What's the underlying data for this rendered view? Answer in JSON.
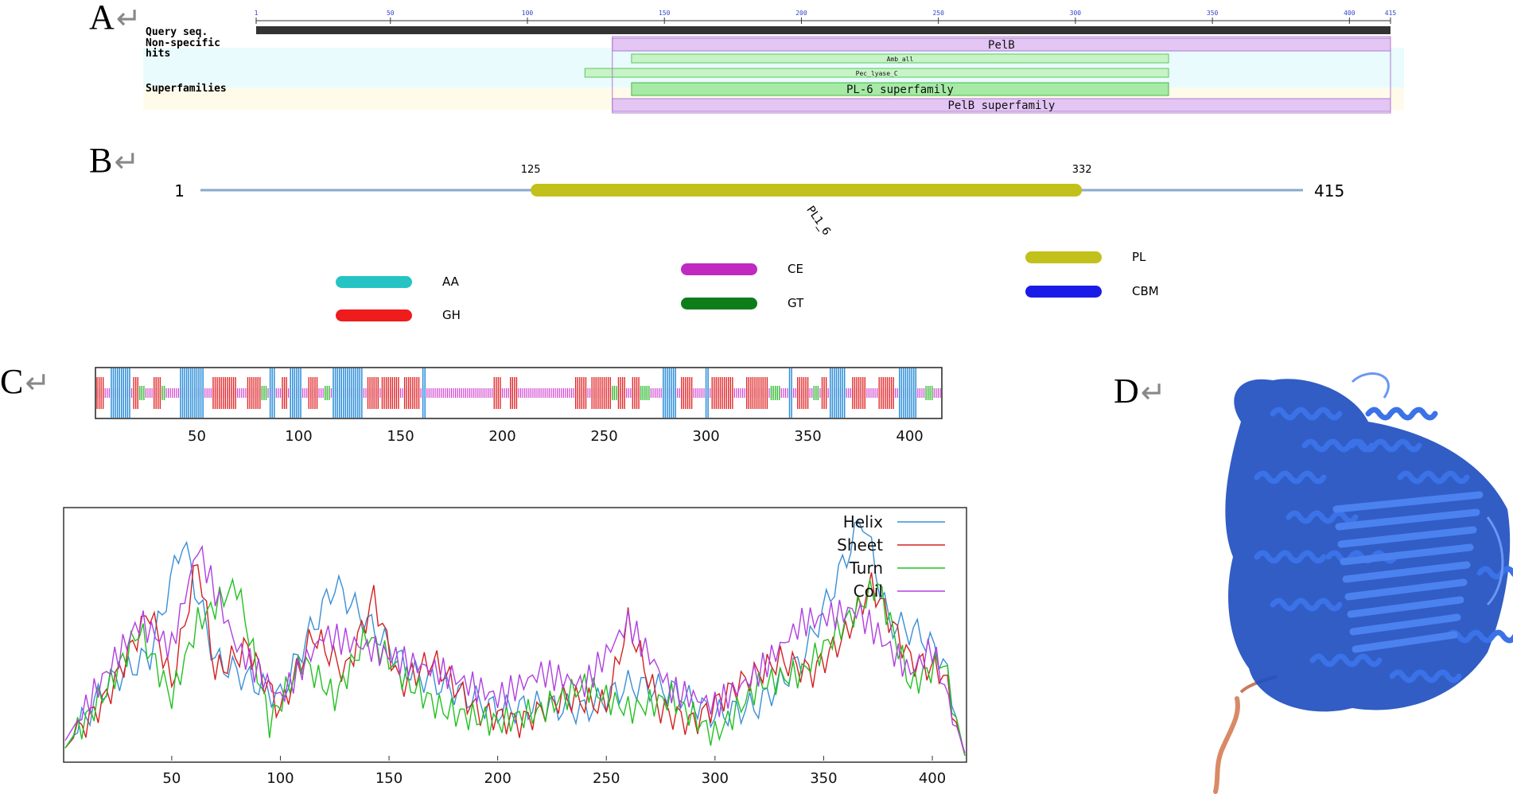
{
  "panels": [
    {
      "letter": "A",
      "mark": "↵"
    },
    {
      "letter": "B",
      "mark": "↵"
    },
    {
      "letter": "C",
      "mark": "↵"
    },
    {
      "letter": "D",
      "mark": "↵"
    }
  ],
  "panel_a": {
    "row_labels": [
      "Query seq.",
      "Non-specific",
      "hits",
      "Superfamilies"
    ],
    "ticks": [
      "1",
      "50",
      "100",
      "150",
      "200",
      "250",
      "300",
      "350",
      "400",
      "415"
    ],
    "tick_values": [
      1,
      50,
      100,
      150,
      200,
      250,
      300,
      350,
      400,
      415
    ],
    "domains": [
      {
        "label": "PelB",
        "start": 131,
        "end": 415,
        "row": 0,
        "color": "#e3c6f4",
        "stroke": "#b07ad0"
      },
      {
        "label": "Amb_all",
        "start": 138,
        "end": 334,
        "row": 1,
        "color": "#c7f3c7",
        "stroke": "#5cc85c"
      },
      {
        "label": "Pec_lyase_C",
        "start": 121,
        "end": 334,
        "row": 2,
        "color": "#c7f3c7",
        "stroke": "#5cc85c"
      },
      {
        "label": "PL-6 superfamily",
        "start": 138,
        "end": 334,
        "row": 3,
        "color": "#a6eaa6",
        "stroke": "#45b845"
      },
      {
        "label": "PelB superfamily",
        "start": 131,
        "end": 415,
        "row": 4,
        "color": "#e3c6f4",
        "stroke": "#b07ad0"
      }
    ]
  },
  "panel_b": {
    "start_label": "1",
    "end_label": "415",
    "domain": {
      "start": 125,
      "end": 332,
      "start_label": "125",
      "end_label": "332",
      "name": "PL1_6",
      "color": "#c2c01a"
    },
    "legend": [
      {
        "label": "AA",
        "color": "#25c4c4"
      },
      {
        "label": "GH",
        "color": "#ee1c1c"
      },
      {
        "label": "CE",
        "color": "#c02ac0"
      },
      {
        "label": "GT",
        "color": "#0d7d1a"
      },
      {
        "label": "PL",
        "color": "#c2c01a"
      },
      {
        "label": "CBM",
        "color": "#1b1be8"
      }
    ]
  },
  "panel_c_track": {
    "ticks": [
      "50",
      "100",
      "150",
      "200",
      "250",
      "300",
      "350",
      "400"
    ],
    "tick_values": [
      50,
      100,
      150,
      200,
      250,
      300,
      350,
      400
    ],
    "helix_blocks": [
      [
        8,
        17
      ],
      [
        42,
        53
      ],
      [
        86,
        88
      ],
      [
        96,
        101
      ],
      [
        117,
        131
      ],
      [
        161,
        162
      ],
      [
        279,
        285
      ],
      [
        300,
        301
      ],
      [
        341,
        342
      ],
      [
        361,
        368
      ],
      [
        395,
        403
      ]
    ],
    "sheet_blocks": [
      [
        1,
        4
      ],
      [
        19,
        21
      ],
      [
        29,
        32
      ],
      [
        58,
        69
      ],
      [
        75,
        81
      ],
      [
        92,
        94
      ],
      [
        105,
        109
      ],
      [
        134,
        139
      ],
      [
        141,
        149
      ],
      [
        152,
        159
      ],
      [
        196,
        199
      ],
      [
        204,
        207
      ],
      [
        236,
        241
      ],
      [
        244,
        253
      ],
      [
        257,
        260
      ],
      [
        264,
        267
      ],
      [
        288,
        293
      ],
      [
        303,
        313
      ],
      [
        320,
        330
      ],
      [
        345,
        350
      ],
      [
        357,
        359
      ],
      [
        372,
        378
      ],
      [
        385,
        392
      ]
    ],
    "turn_blocks": [
      [
        22,
        24
      ],
      [
        33,
        34
      ],
      [
        82,
        84
      ],
      [
        113,
        115
      ],
      [
        254,
        256
      ],
      [
        268,
        272
      ],
      [
        332,
        336
      ],
      [
        353,
        355
      ],
      [
        408,
        411
      ]
    ]
  },
  "chart_data": {
    "type": "line",
    "xlim": [
      1,
      415
    ],
    "ylim": [
      0,
      1
    ],
    "xticks": [
      "50",
      "100",
      "150",
      "200",
      "250",
      "300",
      "350",
      "400"
    ],
    "xtick_values": [
      50,
      100,
      150,
      200,
      250,
      300,
      350,
      400
    ],
    "legend_position": "top-right",
    "series": [
      {
        "name": "Helix",
        "color": "#3a8fd6",
        "x": [
          1,
          20,
          40,
          55,
          70,
          90,
          100,
          110,
          125,
          140,
          160,
          180,
          200,
          220,
          240,
          260,
          280,
          300,
          320,
          340,
          355,
          368,
          380,
          395,
          405,
          415
        ],
        "y": [
          0.05,
          0.3,
          0.42,
          0.88,
          0.4,
          0.3,
          0.25,
          0.45,
          0.7,
          0.55,
          0.35,
          0.28,
          0.2,
          0.22,
          0.2,
          0.3,
          0.28,
          0.18,
          0.22,
          0.4,
          0.7,
          0.97,
          0.55,
          0.5,
          0.4,
          0.02
        ]
      },
      {
        "name": "Sheet",
        "color": "#d42020",
        "x": [
          1,
          20,
          40,
          50,
          62,
          70,
          85,
          100,
          115,
          130,
          143,
          155,
          170,
          190,
          210,
          230,
          250,
          260,
          275,
          290,
          310,
          330,
          345,
          360,
          372,
          390,
          405,
          415
        ],
        "y": [
          0.05,
          0.25,
          0.6,
          0.3,
          0.8,
          0.35,
          0.45,
          0.2,
          0.5,
          0.35,
          0.65,
          0.3,
          0.4,
          0.2,
          0.15,
          0.25,
          0.22,
          0.55,
          0.2,
          0.15,
          0.3,
          0.4,
          0.35,
          0.5,
          0.7,
          0.4,
          0.35,
          0.02
        ]
      },
      {
        "name": "Turn",
        "color": "#22c022",
        "x": [
          1,
          20,
          35,
          50,
          62,
          80,
          95,
          110,
          125,
          140,
          160,
          175,
          200,
          220,
          240,
          260,
          280,
          300,
          320,
          340,
          360,
          375,
          390,
          405,
          415
        ],
        "y": [
          0.05,
          0.28,
          0.52,
          0.25,
          0.55,
          0.7,
          0.15,
          0.4,
          0.25,
          0.5,
          0.3,
          0.2,
          0.15,
          0.2,
          0.3,
          0.2,
          0.25,
          0.1,
          0.3,
          0.35,
          0.55,
          0.7,
          0.3,
          0.4,
          0.02
        ]
      },
      {
        "name": "Coil",
        "color": "#b040e0",
        "x": [
          1,
          20,
          35,
          50,
          62,
          80,
          100,
          120,
          140,
          155,
          175,
          200,
          220,
          240,
          260,
          280,
          300,
          320,
          340,
          365,
          375,
          390,
          400,
          415
        ],
        "y": [
          0.08,
          0.35,
          0.55,
          0.45,
          0.85,
          0.45,
          0.25,
          0.5,
          0.45,
          0.4,
          0.35,
          0.25,
          0.35,
          0.3,
          0.55,
          0.28,
          0.22,
          0.35,
          0.55,
          0.6,
          0.5,
          0.35,
          0.45,
          0.03
        ]
      }
    ]
  },
  "panel_d": {
    "main_color": "#2a5bd0",
    "tail_color": "#d88a66"
  }
}
